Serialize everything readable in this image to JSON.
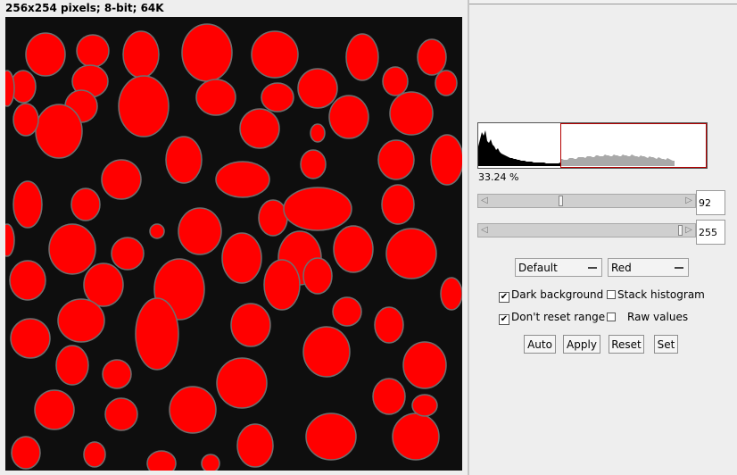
{
  "image_window": {
    "info": "256x254 pixels; 8-bit; 64K"
  },
  "threshold": {
    "histogram_percent": "33.24 %",
    "min_value": "92",
    "max_value": "255",
    "min_fraction": 0.361,
    "max_fraction": 1.0,
    "method": "Default",
    "display": "Red",
    "dark_background": {
      "label": "Dark background",
      "checked": true
    },
    "stack_histogram": {
      "label": "Stack histogram",
      "checked": false
    },
    "dont_reset_range": {
      "label": "Don't reset range",
      "checked": true
    },
    "raw_values": {
      "label": "Raw values",
      "checked": false
    },
    "buttons": {
      "auto": "Auto",
      "apply": "Apply",
      "reset": "Reset",
      "set": "Set"
    }
  },
  "colors": {
    "overlay": "#ff0000",
    "histogram_selection": "#b40000",
    "background": "#0e0e0e"
  }
}
